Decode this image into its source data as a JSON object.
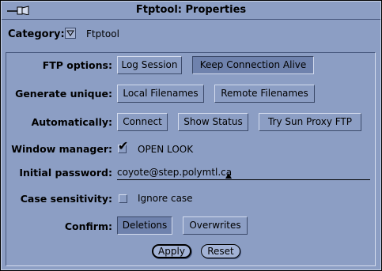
{
  "window": {
    "title": "Ftptool: Properties"
  },
  "category": {
    "label": "Category:",
    "value": "Ftptool"
  },
  "ftp_options": {
    "label": "FTP options:",
    "buttons": [
      {
        "label": "Log Session",
        "selected": false
      },
      {
        "label": "Keep Connection Alive",
        "selected": true
      }
    ]
  },
  "generate_unique": {
    "label": "Generate unique:",
    "buttons": [
      {
        "label": "Local Filenames",
        "selected": false
      },
      {
        "label": "Remote Filenames",
        "selected": false
      }
    ]
  },
  "automatically": {
    "label": "Automatically:",
    "buttons": [
      {
        "label": "Connect",
        "selected": false
      },
      {
        "label": "Show Status",
        "selected": false
      },
      {
        "label": "Try Sun Proxy FTP",
        "selected": false
      }
    ]
  },
  "window_manager": {
    "label": "Window manager:",
    "option": "OPEN LOOK",
    "checked": true
  },
  "initial_password": {
    "label": "Initial password:",
    "value": "coyote@step.polymtl.ca"
  },
  "case_sensitivity": {
    "label": "Case sensitivity:",
    "option": "Ignore case",
    "checked": false
  },
  "confirm": {
    "label": "Confirm:",
    "buttons": [
      {
        "label": "Deletions",
        "selected": true
      },
      {
        "label": "Overwrites",
        "selected": false
      }
    ]
  },
  "actions": {
    "apply": "Apply",
    "reset": "Reset"
  },
  "colors": {
    "background": "#8c9ec4",
    "selected": "#6f82ad",
    "border_light": "#d4dcee",
    "border_dark": "#3c4a6a"
  }
}
